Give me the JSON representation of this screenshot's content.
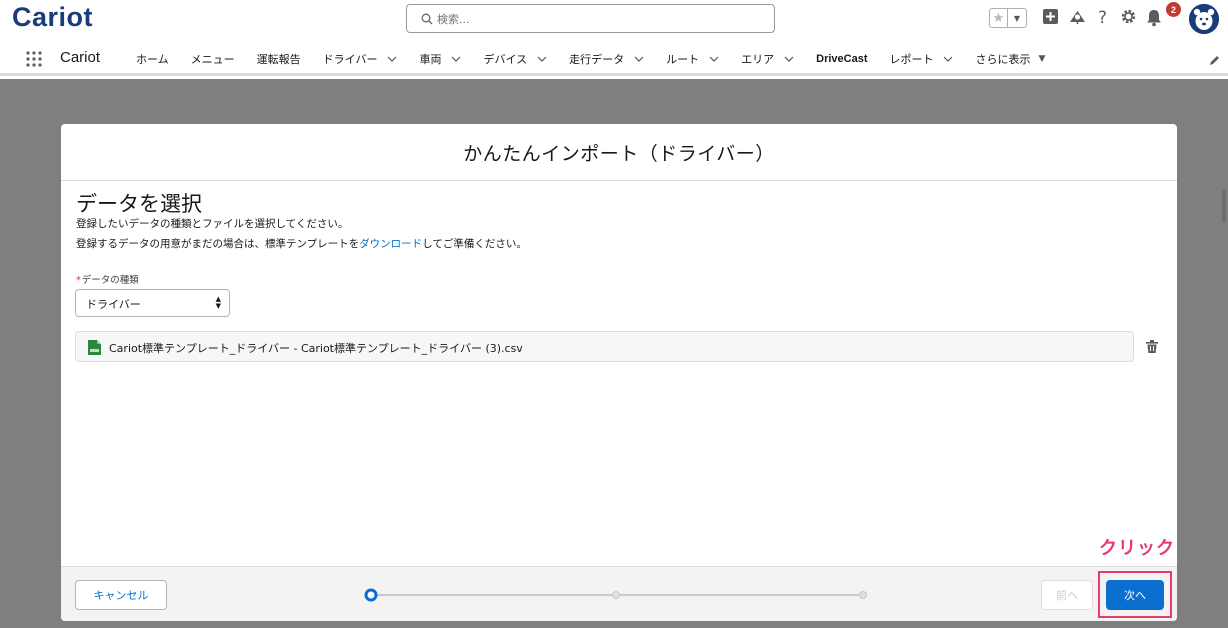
{
  "header": {
    "logo_text": "Cariot",
    "search_placeholder": "検索...",
    "notification_count": "2"
  },
  "nav": {
    "app_name": "Cariot",
    "items": [
      {
        "label": "ホーム",
        "chevron": false
      },
      {
        "label": "メニュー",
        "chevron": false
      },
      {
        "label": "運転報告",
        "chevron": false
      },
      {
        "label": "ドライバー",
        "chevron": true
      },
      {
        "label": "車両",
        "chevron": true
      },
      {
        "label": "デバイス",
        "chevron": true
      },
      {
        "label": "走行データ",
        "chevron": true
      },
      {
        "label": "ルート",
        "chevron": true
      },
      {
        "label": "エリア",
        "chevron": true
      },
      {
        "label": "DriveCast",
        "chevron": false
      },
      {
        "label": "レポート",
        "chevron": true
      },
      {
        "label": "さらに表示",
        "chevron": false
      }
    ]
  },
  "modal": {
    "title": "かんたんインポート（ドライバー）",
    "section_title": "データを選択",
    "description_line1": "登録したいデータの種類とファイルを選択してください。",
    "description_line2_prefix": "登録するデータの用意がまだの場合は、標準テンプレートを",
    "description_line2_link": "ダウンロード",
    "description_line2_suffix": "してご準備ください。",
    "field_label": "データの種類",
    "field_required_mark": "*",
    "select_value": "ドライバー",
    "file_name": "Cariot標準テンプレート_ドライバー - Cariot標準テンプレート_ドライバー (3).csv",
    "footer": {
      "cancel_label": "キャンセル",
      "prev_label": "前へ",
      "next_label": "次へ",
      "progress_steps": 3,
      "progress_current": 1
    }
  },
  "annotation": {
    "click_text": "クリック"
  },
  "colors": {
    "brand": "#1a3c78",
    "primary": "#0b6fcf",
    "annotation": "#e8386d",
    "badge": "#c23934"
  }
}
